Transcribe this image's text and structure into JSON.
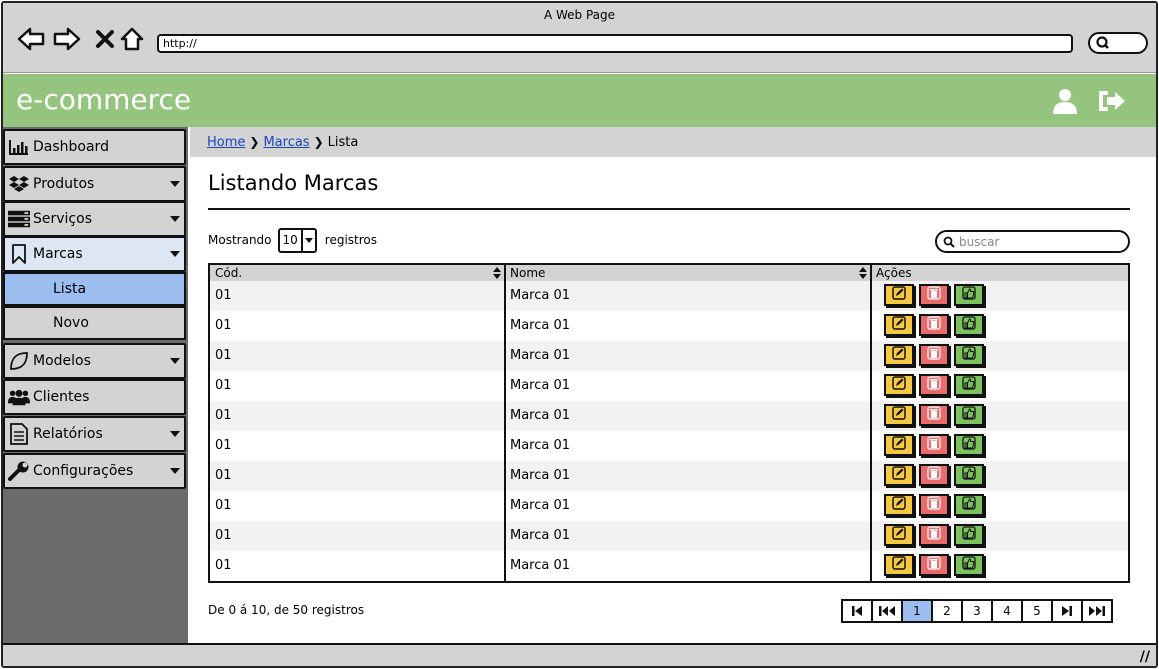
{
  "browser": {
    "title": "A Web Page",
    "url": "http://"
  },
  "app": {
    "brand": "e-commerce",
    "header_icons": [
      "user-icon",
      "logout-icon"
    ]
  },
  "sidebar": {
    "items": [
      {
        "label": "Dashboard",
        "icon": "bar-chart-icon",
        "has_caret": false
      },
      {
        "label": "Produtos",
        "icon": "dropbox-icon",
        "has_caret": true
      },
      {
        "label": "Serviços",
        "icon": "server-icon",
        "has_caret": true
      },
      {
        "label": "Marcas",
        "icon": "bookmark-icon",
        "has_caret": true
      },
      {
        "label": "Modelos",
        "icon": "leaf-icon",
        "has_caret": true
      },
      {
        "label": "Clientes",
        "icon": "users-icon",
        "has_caret": false
      },
      {
        "label": "Relatórios",
        "icon": "document-icon",
        "has_caret": true
      },
      {
        "label": "Configurações",
        "icon": "wrench-icon",
        "has_caret": true
      }
    ],
    "submenu": [
      {
        "label": "Lista",
        "selected": true
      },
      {
        "label": "Novo",
        "selected": false
      }
    ]
  },
  "breadcrumb": {
    "home": "Home",
    "marcas": "Marcas",
    "current": "Lista"
  },
  "page": {
    "title": "Listando Marcas"
  },
  "controls": {
    "show_prefix": "Mostrando",
    "show_value": "10",
    "show_suffix": "registros",
    "search_placeholder": "buscar"
  },
  "table": {
    "columns": [
      "Cód.",
      "Nome",
      "Ações"
    ],
    "rows": [
      {
        "cod": "01",
        "nome": "Marca 01"
      },
      {
        "cod": "01",
        "nome": "Marca 01"
      },
      {
        "cod": "01",
        "nome": "Marca 01"
      },
      {
        "cod": "01",
        "nome": "Marca 01"
      },
      {
        "cod": "01",
        "nome": "Marca 01"
      },
      {
        "cod": "01",
        "nome": "Marca 01"
      },
      {
        "cod": "01",
        "nome": "Marca 01"
      },
      {
        "cod": "01",
        "nome": "Marca 01"
      },
      {
        "cod": "01",
        "nome": "Marca 01"
      },
      {
        "cod": "01",
        "nome": "Marca 01"
      }
    ],
    "row_actions": [
      "edit-icon",
      "trash-icon",
      "thumbs-up-icon"
    ]
  },
  "footer": {
    "info": "De 0 á 10, de 50 registros"
  },
  "pagination": {
    "pages": [
      "1",
      "2",
      "3",
      "4",
      "5"
    ],
    "current": "1"
  },
  "colors": {
    "header_green": "#94c47d",
    "selected_blue": "#9bbdf0",
    "edit_yellow": "#f5c842",
    "delete_red": "#e96b6b",
    "approve_green": "#7cc25f"
  }
}
